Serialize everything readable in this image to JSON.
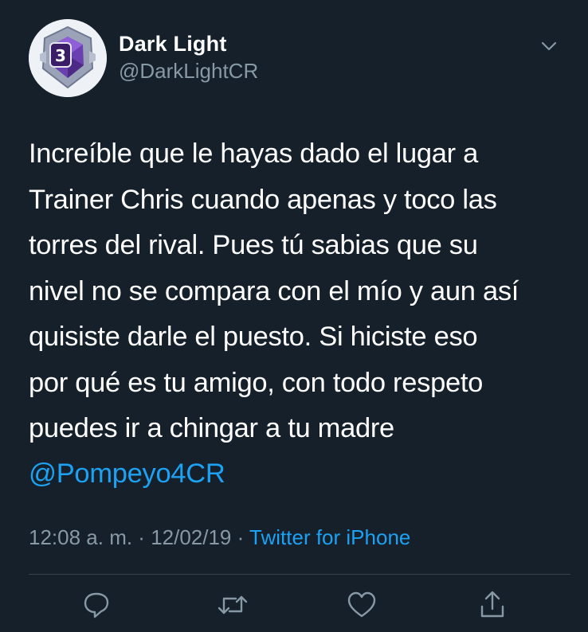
{
  "user": {
    "display_name": "Dark Light",
    "handle": "@DarkLightCR",
    "avatar_badge_number": "3"
  },
  "tweet": {
    "text": "Increíble que le hayas dado el lugar a\nTrainer Chris cuando apenas y toco las\ntorres del rival. Pues tú sabias que su\nnivel no se compara con el mío y aun así\nquisiste darle el puesto. Si hiciste eso\npor qué es tu amigo, con todo respeto\npuedes ir a chingar a tu madre",
    "mention": "@Pompeyo4CR"
  },
  "meta": {
    "time": "12:08 a. m.",
    "separator": " · ",
    "date": "12/02/19",
    "source": "Twitter for iPhone"
  },
  "actions": [
    {
      "name": "reply",
      "icon": "reply-icon"
    },
    {
      "name": "retweet",
      "icon": "retweet-icon"
    },
    {
      "name": "like",
      "icon": "heart-icon"
    },
    {
      "name": "share",
      "icon": "share-icon"
    }
  ],
  "colors": {
    "background": "#15202b",
    "primary_text": "#ffffff",
    "secondary_text": "#8899a6",
    "accent": "#1da1f2",
    "divider": "#38444d"
  }
}
